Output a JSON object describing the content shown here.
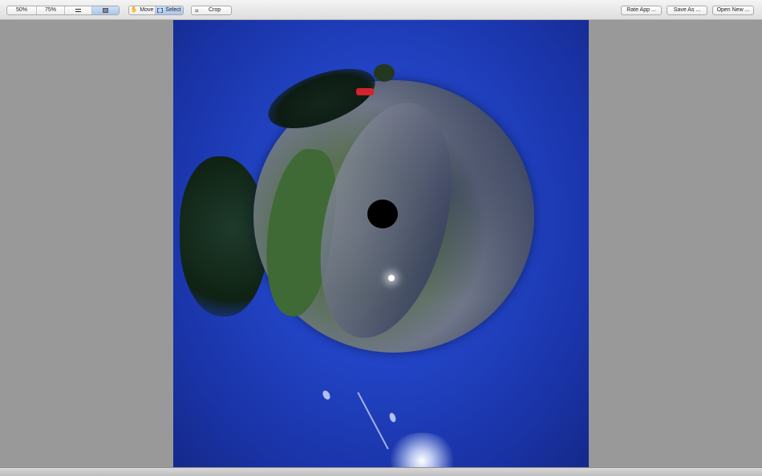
{
  "toolbar": {
    "zoom": {
      "options": [
        "50%",
        "75%"
      ],
      "fit_icon": "fit-to-window-icon",
      "fill_icon": "fill-window-icon"
    },
    "tool": {
      "move_label": "Move",
      "move_icon": "hand-icon",
      "select_label": "Select",
      "select_icon": "selection-rect-icon",
      "selected": "Select"
    },
    "crop_label": "Crop",
    "crop_icon": "crop-icon",
    "rate_label": "Rate App ...",
    "save_label": "Save As ...",
    "open_label": "Open New ..."
  },
  "canvas": {
    "image": "little-planet-panorama",
    "background_color": "#2244c6"
  },
  "colors": {
    "toolbar_bg": "#e6e6e6",
    "window_bg": "#999999",
    "selected_segment": "#b6cff0"
  }
}
